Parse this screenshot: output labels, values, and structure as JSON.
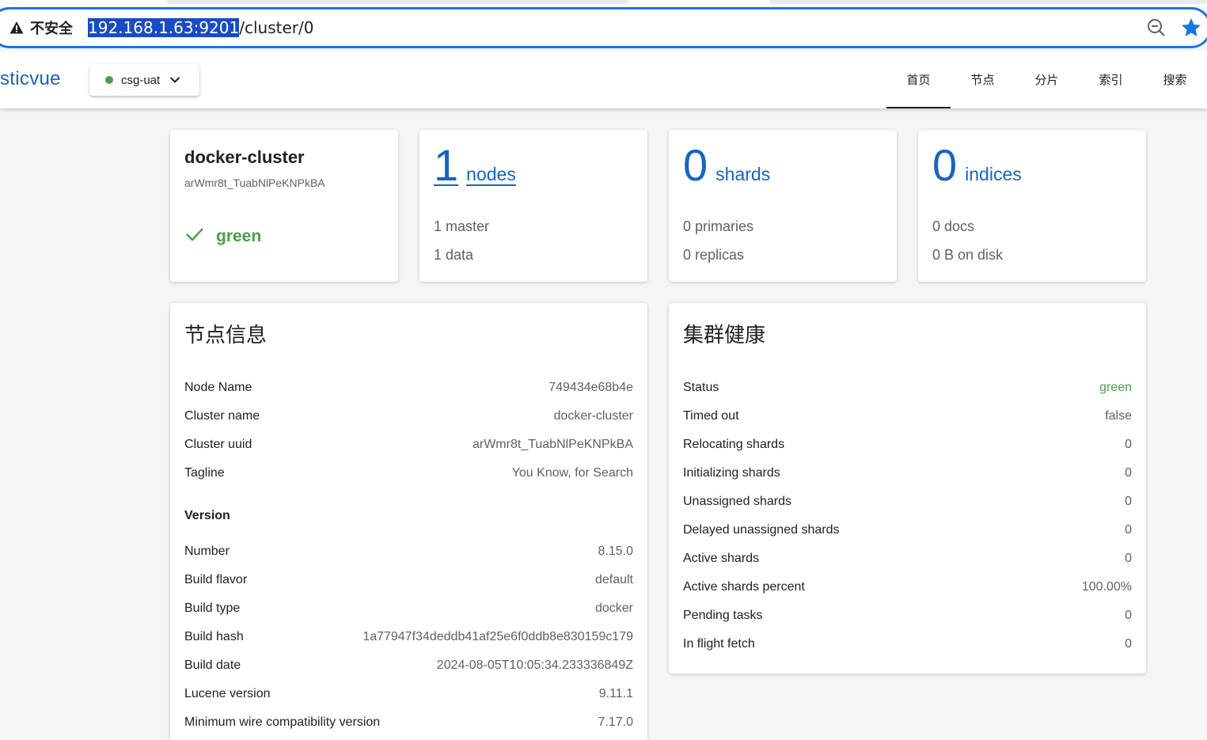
{
  "browser": {
    "security_label": "不安全",
    "url_host": "192.168.1.63:9201",
    "url_path": "/cluster/0"
  },
  "app": {
    "logo": "sticvue",
    "cluster_selector": {
      "value": "csg-uat",
      "status_color": "#43a047"
    },
    "nav": [
      "首页",
      "节点",
      "分片",
      "索引",
      "搜索"
    ],
    "active_nav": 0
  },
  "summary": {
    "cluster": {
      "name": "docker-cluster",
      "uuid": "arWmr8t_TuabNlPeKNPkBA",
      "health": "green"
    },
    "nodes": {
      "count": "1",
      "label": "nodes",
      "master": "1 master",
      "data": "1 data"
    },
    "shards": {
      "count": "0",
      "label": "shards",
      "primaries": "0 primaries",
      "replicas": "0 replicas"
    },
    "indices": {
      "count": "0",
      "label": "indices",
      "docs": "0 docs",
      "disk": "0 B on disk"
    }
  },
  "node_info": {
    "title": "节点信息",
    "rows": [
      {
        "key": "Node Name",
        "value": "749434e68b4e"
      },
      {
        "key": "Cluster name",
        "value": "docker-cluster"
      },
      {
        "key": "Cluster uuid",
        "value": "arWmr8t_TuabNlPeKNPkBA"
      },
      {
        "key": "Tagline",
        "value": "You Know, for Search"
      }
    ],
    "version_heading": "Version",
    "version_rows": [
      {
        "key": "Number",
        "value": "8.15.0"
      },
      {
        "key": "Build flavor",
        "value": "default"
      },
      {
        "key": "Build type",
        "value": "docker"
      },
      {
        "key": "Build hash",
        "value": "1a77947f34deddb41af25e6f0ddb8e830159c179"
      },
      {
        "key": "Build date",
        "value": "2024-08-05T10:05:34.233336849Z"
      },
      {
        "key": "Lucene version",
        "value": "9.11.1"
      },
      {
        "key": "Minimum wire compatibility version",
        "value": "7.17.0"
      }
    ]
  },
  "cluster_health": {
    "title": "集群健康",
    "rows": [
      {
        "key": "Status",
        "value": "green"
      },
      {
        "key": "Timed out",
        "value": "false"
      },
      {
        "key": "Relocating shards",
        "value": "0"
      },
      {
        "key": "Initializing shards",
        "value": "0"
      },
      {
        "key": "Unassigned shards",
        "value": "0"
      },
      {
        "key": "Delayed unassigned shards",
        "value": "0"
      },
      {
        "key": "Active shards",
        "value": "0"
      },
      {
        "key": "Active shards percent",
        "value": "100.00%"
      },
      {
        "key": "Pending tasks",
        "value": "0"
      },
      {
        "key": "In flight fetch",
        "value": "0"
      }
    ]
  },
  "colors": {
    "accent": "#1565c0",
    "healthy": "#43a047",
    "omnibox_border": "#1a73e8"
  }
}
